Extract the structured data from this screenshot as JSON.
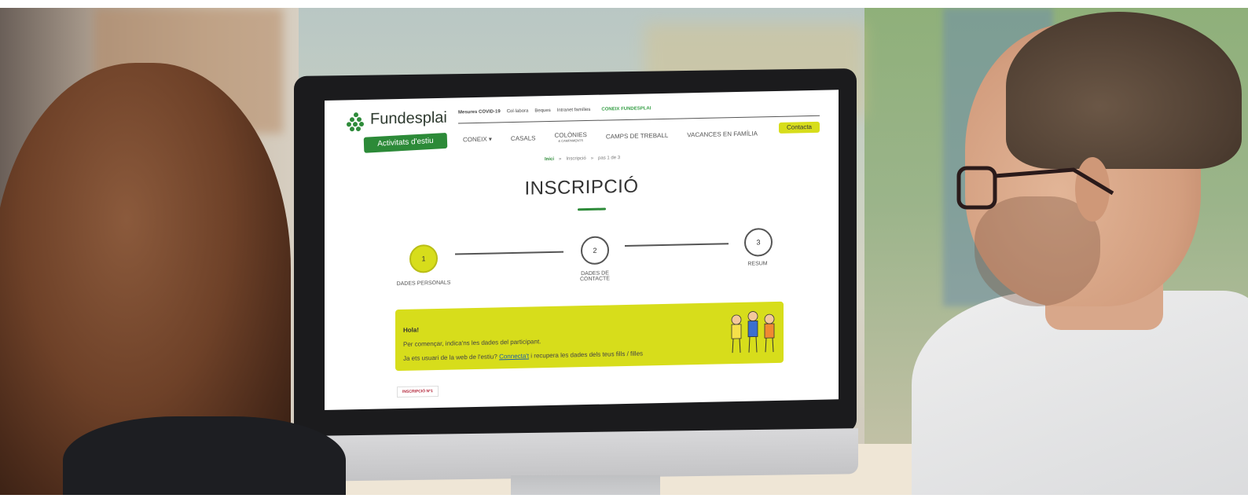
{
  "site": {
    "brand": "Fundesplai",
    "brand_sub": "Activitats d'estiu",
    "topbar": [
      "Mesures COVID-19",
      "Col·labora",
      "Beques",
      "Intranet famílies",
      "CONEIX FUNDESPLAI"
    ],
    "nav": [
      {
        "label": "CONEIX ▾",
        "sub": ""
      },
      {
        "label": "CASALS",
        "sub": ""
      },
      {
        "label": "COLÒNIES",
        "sub": "& CAMPAMENTS"
      },
      {
        "label": "CAMPS DE TREBALL",
        "sub": ""
      },
      {
        "label": "VACANCES EN FAMÍLIA",
        "sub": ""
      }
    ],
    "contact_label": "Contacta",
    "breadcrumb": [
      "Inici",
      "»",
      "Inscripció",
      "»",
      "pas 1 de 3"
    ]
  },
  "page": {
    "title": "INSCRIPCIÓ",
    "steps": [
      {
        "number": "1",
        "label": "DADES PERSONALS"
      },
      {
        "number": "2",
        "label": "DADES DE CONTACTE"
      },
      {
        "number": "3",
        "label": "RESUM"
      }
    ],
    "notice": {
      "hello": "Hola!",
      "line1": "Per començar, indica'ns les dades del participant.",
      "line2_pre": "Ja ets usuari de la web de l'estiu?",
      "line2_link": "Connecta't",
      "line2_post": "i recupera les dades dels teus fills / filles"
    },
    "tab_label": "INSCRIPCIÓ Nº1"
  },
  "colors": {
    "accent_green": "#2e8b3a",
    "accent_yellow": "#d7dd1b"
  }
}
